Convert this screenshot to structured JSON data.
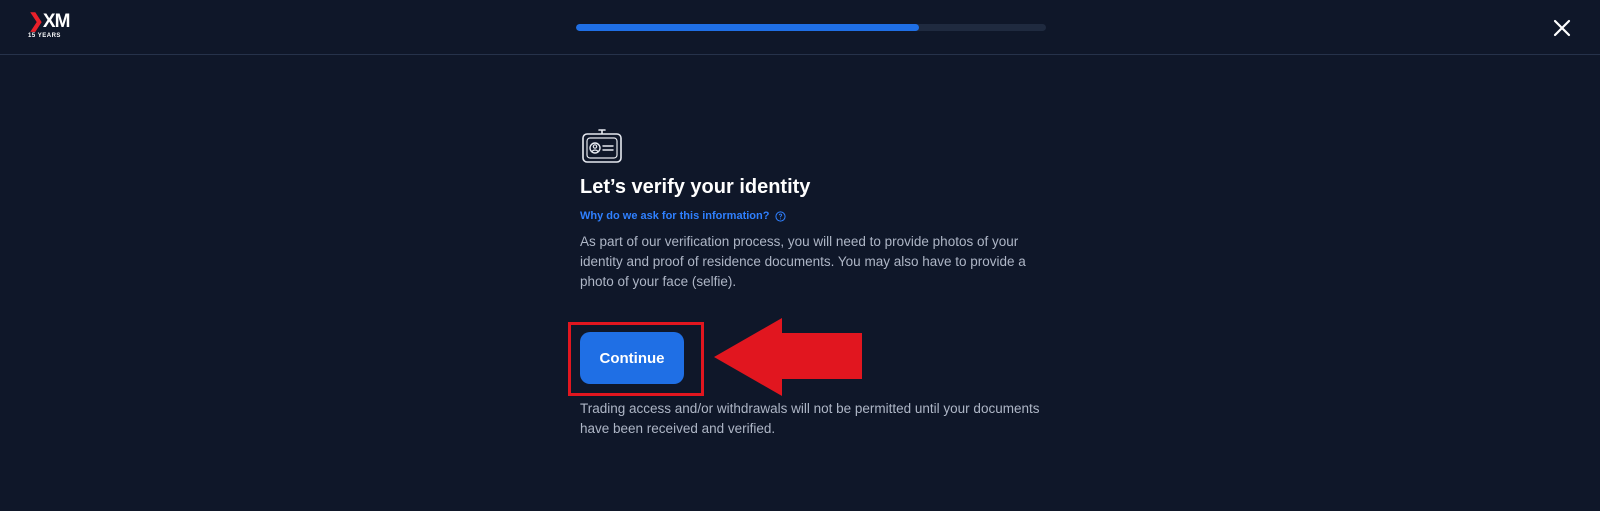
{
  "header": {
    "logo_text": "XM",
    "logo_sub": "15 YEARS",
    "progress": 0.73,
    "close_icon": "close-icon"
  },
  "main": {
    "icon": "id-card-icon",
    "title": "Let’s verify your identity",
    "why_link": "Why do we ask for this information?",
    "why_icon": "help-circle-icon",
    "description": "As part of our verification process, you will need to provide photos of your identity and proof of residence documents. You may also have to provide a photo of your face (selfie).",
    "continue_label": "Continue",
    "note": "Trading access and/or withdrawals will not be permitted until your documents have been received and verified."
  },
  "annotation": {
    "highlight_color": "#e1161f",
    "arrow_icon": "left-arrow-icon"
  },
  "colors": {
    "background": "#0f1729",
    "accent": "#1f6fe5",
    "link": "#2f80ff"
  }
}
